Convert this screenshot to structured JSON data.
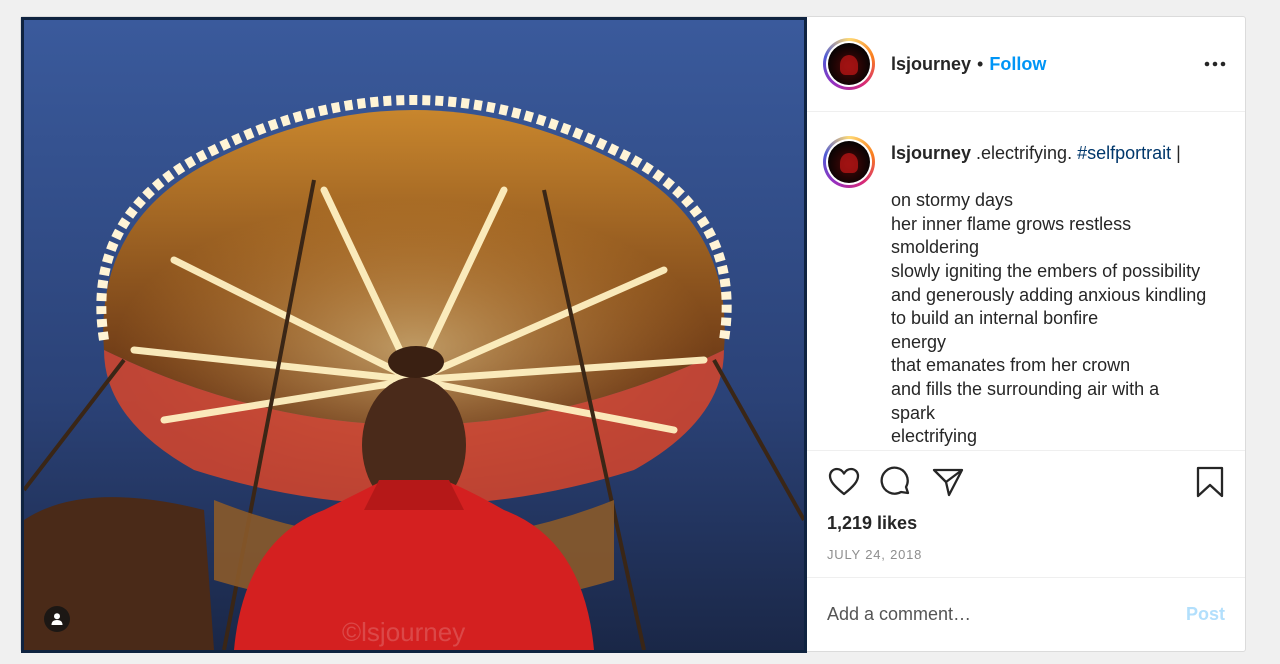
{
  "post": {
    "username": "lsjourney",
    "separator": "•",
    "follow_label": "Follow",
    "more_icon": "more-horizontal-icon",
    "caption": {
      "username": "lsjourney",
      "first_line_text": " .electrifying. ",
      "hashtag": "#selfportrait",
      "first_line_tail": " |",
      "lines": [
        "on stormy days",
        "her inner flame grows restless",
        "smoldering",
        "slowly igniting the embers of possibility",
        "and generously adding anxious kindling",
        "to build an internal bonfire",
        "energy",
        "that emanates from her crown",
        "and fills the surrounding air with a",
        "spark",
        "electrifying"
      ]
    },
    "likes": "1,219 likes",
    "date": "JULY 24, 2018",
    "comment_placeholder": "Add a comment…",
    "post_button_label": "Post",
    "watermark": "©lsjourney",
    "icons": {
      "like": "heart-icon",
      "comment": "comment-icon",
      "share": "paper-plane-icon",
      "save": "bookmark-icon",
      "user_tag": "user-tag-icon"
    },
    "colors": {
      "link": "#0095f6",
      "hashtag": "#00376b",
      "post_disabled": "#b2dffc",
      "muted": "#8e8e8e"
    }
  }
}
